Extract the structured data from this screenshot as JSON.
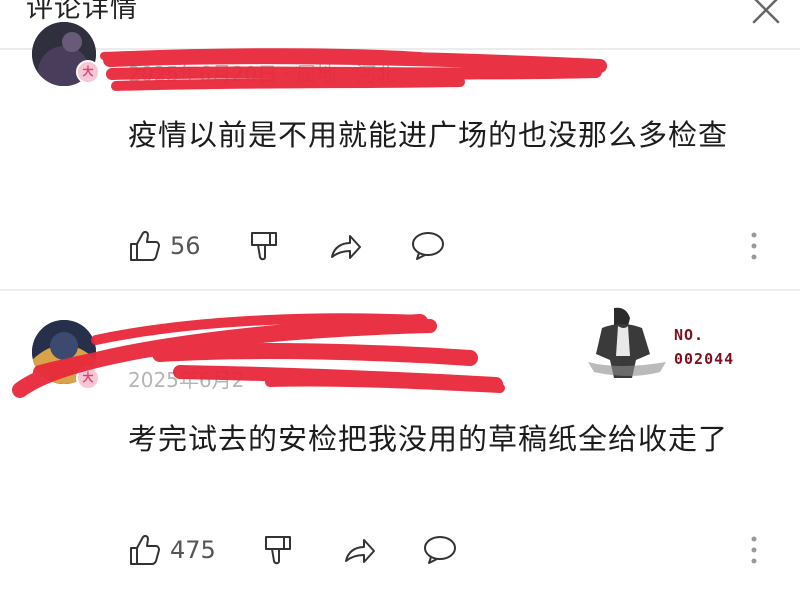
{
  "header": {
    "title": "评论详情"
  },
  "comments": [
    {
      "meta": "2025年6月20日 · 属地：河北",
      "text": "疫情以前是不用就能进广场的也没那么多检查",
      "likes": "56",
      "badge": "大"
    },
    {
      "meta": "2025年6月2",
      "text": "考完试去的安检把我没用的草稿纸全给收走了",
      "likes": "475",
      "badge": "大"
    }
  ],
  "watermark": {
    "line1": "NO.",
    "line2": "002044"
  },
  "colors": {
    "redaction": "#e8283b",
    "badge_bg": "#f7c7d6",
    "badge_fg": "#e2416d",
    "watermark": "#7a1020"
  }
}
